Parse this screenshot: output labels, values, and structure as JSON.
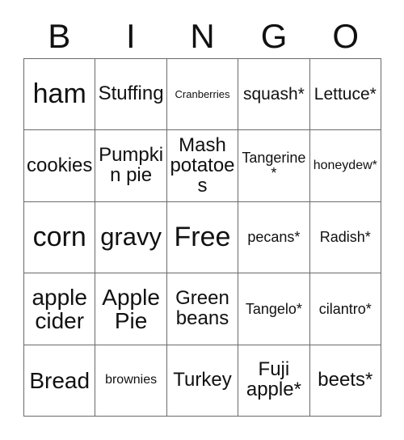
{
  "card": {
    "type": "bingo-card",
    "theme_note": "Thanksgiving bingo card",
    "columns": 5,
    "rows": 5,
    "text_color": "#111111",
    "background_color": "#ffffff",
    "grid_line_color": "#6a6a6a"
  },
  "header": {
    "letters": [
      "B",
      "I",
      "N",
      "G",
      "O"
    ]
  },
  "grid": {
    "rows": [
      {
        "cells": [
          {
            "text": "ham",
            "size": "fs-xxl"
          },
          {
            "text": "Stuffing",
            "size": "fs-md"
          },
          {
            "text": "Cranberries",
            "size": "fs-tiny"
          },
          {
            "text": "squash*",
            "size": "fs-sm"
          },
          {
            "text": "Lettuce*",
            "size": "fs-sm"
          }
        ]
      },
      {
        "cells": [
          {
            "text": "cookies",
            "size": "fs-md"
          },
          {
            "text": "Pumpkin pie",
            "size": "fs-md"
          },
          {
            "text": "Mash potatoes",
            "size": "fs-md"
          },
          {
            "text": "Tangerine*",
            "size": "fs-xs"
          },
          {
            "text": "honeydew*",
            "size": "fs-xxs"
          }
        ]
      },
      {
        "cells": [
          {
            "text": "corn",
            "size": "fs-xxl"
          },
          {
            "text": "gravy",
            "size": "fs-xl"
          },
          {
            "text": "Free",
            "size": "fs-xxl"
          },
          {
            "text": "pecans*",
            "size": "fs-xs"
          },
          {
            "text": "Radish*",
            "size": "fs-xs"
          }
        ]
      },
      {
        "cells": [
          {
            "text": "apple cider",
            "size": "fs-lg"
          },
          {
            "text": "Apple Pie",
            "size": "fs-lg"
          },
          {
            "text": "Green beans",
            "size": "fs-md"
          },
          {
            "text": "Tangelo*",
            "size": "fs-xs"
          },
          {
            "text": "cilantro*",
            "size": "fs-xs"
          }
        ]
      },
      {
        "cells": [
          {
            "text": "Bread",
            "size": "fs-lg"
          },
          {
            "text": "brownies",
            "size": "fs-xxs"
          },
          {
            "text": "Turkey",
            "size": "fs-md"
          },
          {
            "text": "Fuji apple*",
            "size": "fs-md"
          },
          {
            "text": "beets*",
            "size": "fs-md"
          }
        ]
      }
    ]
  }
}
